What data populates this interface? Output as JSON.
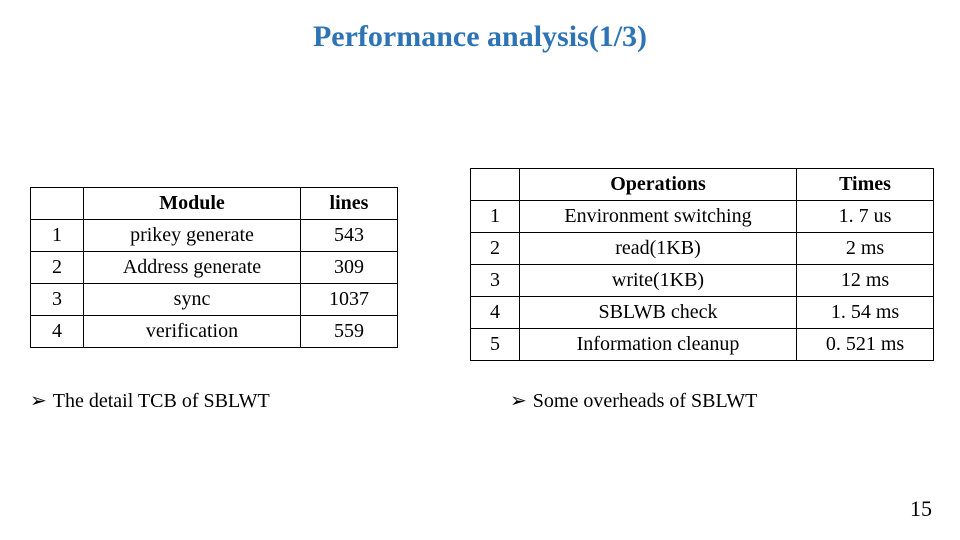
{
  "title": "Performance analysis(1/3)",
  "arrow": "➢",
  "left": {
    "headers": {
      "idx": "",
      "module": "Module",
      "lines": "lines"
    },
    "rows": [
      {
        "idx": "1",
        "module": "prikey generate",
        "lines": "543"
      },
      {
        "idx": "2",
        "module": "Address generate",
        "lines": "309"
      },
      {
        "idx": "3",
        "module": "sync",
        "lines": "1037"
      },
      {
        "idx": "4",
        "module": "verification",
        "lines": "559"
      }
    ],
    "caption": "The detail TCB of SBLWT"
  },
  "right": {
    "headers": {
      "idx": "",
      "op": "Operations",
      "times": "Times"
    },
    "rows": [
      {
        "idx": "1",
        "op": "Environment switching",
        "times": "1. 7 us"
      },
      {
        "idx": "2",
        "op": "read(1KB)",
        "times": "2 ms"
      },
      {
        "idx": "3",
        "op": "write(1KB)",
        "times": "12 ms"
      },
      {
        "idx": "4",
        "op": "SBLWB check",
        "times": "1. 54 ms"
      },
      {
        "idx": "5",
        "op": "Information cleanup",
        "times": "0. 521 ms"
      }
    ],
    "caption": "Some overheads of SBLWT"
  },
  "page_number": "15"
}
